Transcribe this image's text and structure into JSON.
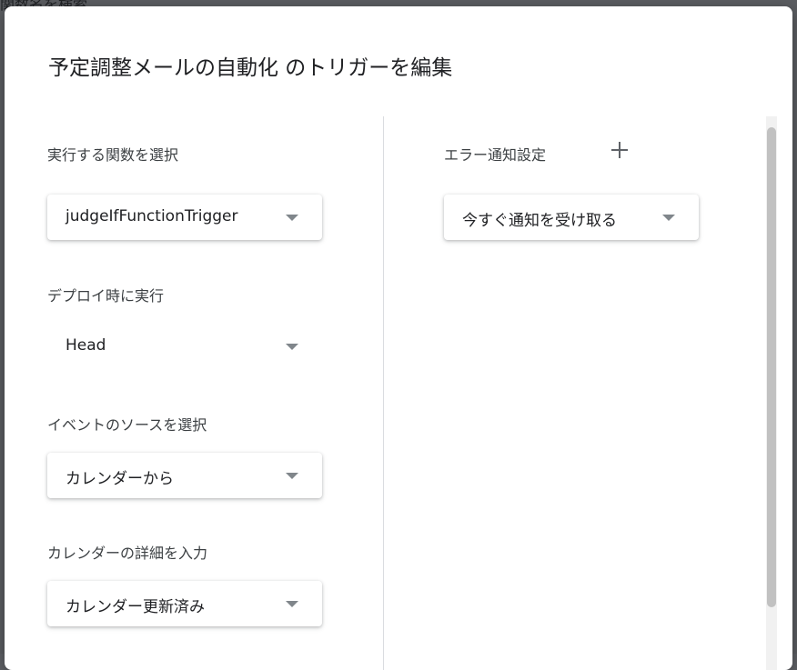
{
  "background": {
    "snippet": "関数名を検索"
  },
  "dialog": {
    "title": "予定調整メールの自動化 のトリガーを編集",
    "left": {
      "function_label": "実行する関数を選択",
      "function_value": "judgeIfFunctionTrigger",
      "deploy_label": "デプロイ時に実行",
      "deploy_value": "Head",
      "event_source_label": "イベントのソースを選択",
      "event_source_value": "カレンダーから",
      "calendar_detail_label": "カレンダーの詳細を入力",
      "calendar_detail_value": "カレンダー更新済み"
    },
    "right": {
      "error_notification_label": "エラー通知設定",
      "error_notification_value": "今すぐ通知を受け取る"
    }
  },
  "icons": {
    "add": "plus-icon",
    "dropdown": "chevron-down-icon"
  },
  "colors": {
    "overlay": "#5b5d61",
    "dialog_bg": "#ffffff",
    "text_primary": "#202124",
    "divider": "#dadce0"
  }
}
